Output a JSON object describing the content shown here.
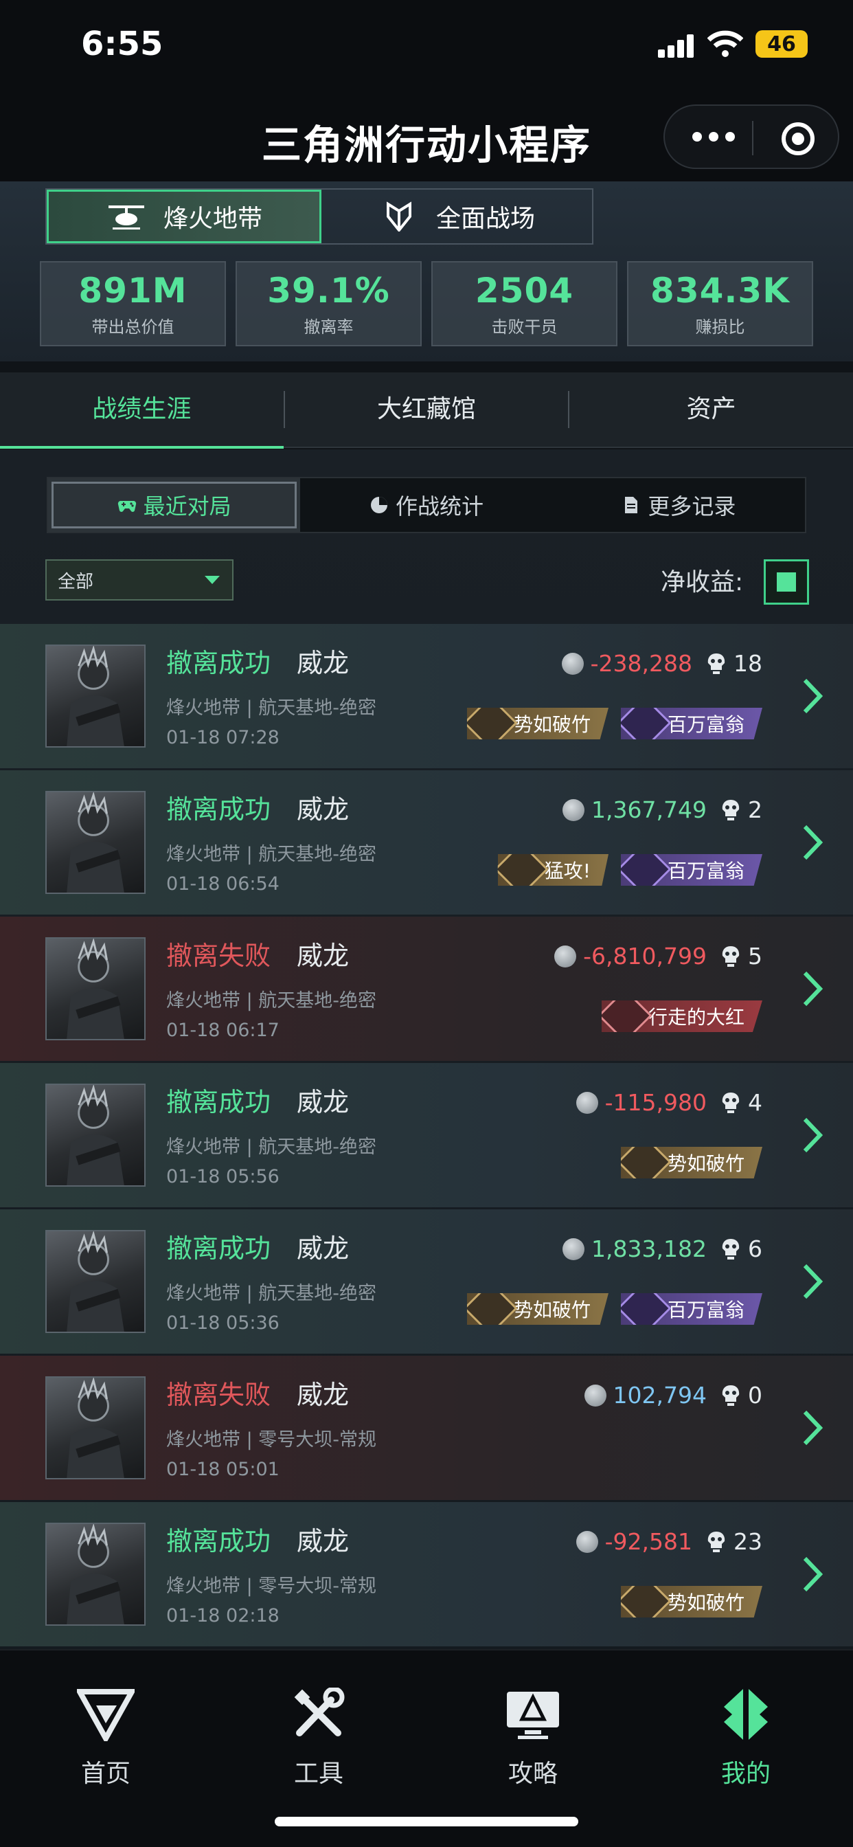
{
  "status_bar": {
    "time": "6:55",
    "battery": "46"
  },
  "header": {
    "title": "三角洲行动小程序"
  },
  "mode_tabs": [
    {
      "label": "烽火地带",
      "active": true
    },
    {
      "label": "全面战场",
      "active": false
    }
  ],
  "stats": [
    {
      "value": "891M",
      "label": "带出总价值"
    },
    {
      "value": "39.1%",
      "label": "撤离率"
    },
    {
      "value": "2504",
      "label": "击败干员"
    },
    {
      "value": "834.3K",
      "label": "赚损比"
    }
  ],
  "main_tabs": [
    {
      "label": "战绩生涯",
      "active": true
    },
    {
      "label": "大红藏馆",
      "active": false
    },
    {
      "label": "资产",
      "active": false
    }
  ],
  "segments": [
    {
      "label": "最近对局",
      "icon": "gamepad-icon",
      "active": true
    },
    {
      "label": "作战统计",
      "icon": "pie-chart-icon",
      "active": false
    },
    {
      "label": "更多记录",
      "icon": "document-icon",
      "active": false
    }
  ],
  "filter": {
    "value": "全部",
    "net_label": "净收益:"
  },
  "matches": [
    {
      "status": "撤离成功",
      "result": "success",
      "operator": "威龙",
      "map": "烽火地带 | 航天基地-绝密",
      "time": "01-18 07:28",
      "value": "-238,288",
      "value_tone": "neg",
      "kills": "18",
      "badges": [
        {
          "label": "势如破竹",
          "tone": "gold"
        },
        {
          "label": "百万富翁",
          "tone": "purple"
        }
      ]
    },
    {
      "status": "撤离成功",
      "result": "success",
      "operator": "威龙",
      "map": "烽火地带 | 航天基地-绝密",
      "time": "01-18 06:54",
      "value": "1,367,749",
      "value_tone": "pos",
      "kills": "2",
      "badges": [
        {
          "label": "猛攻!",
          "tone": "gold"
        },
        {
          "label": "百万富翁",
          "tone": "purple"
        }
      ]
    },
    {
      "status": "撤离失败",
      "result": "fail",
      "operator": "威龙",
      "map": "烽火地带 | 航天基地-绝密",
      "time": "01-18 06:17",
      "value": "-6,810,799",
      "value_tone": "neg",
      "kills": "5",
      "badges": [
        {
          "label": "行走的大红",
          "tone": "red"
        }
      ]
    },
    {
      "status": "撤离成功",
      "result": "success",
      "operator": "威龙",
      "map": "烽火地带 | 航天基地-绝密",
      "time": "01-18 05:56",
      "value": "-115,980",
      "value_tone": "neg",
      "kills": "4",
      "badges": [
        {
          "label": "势如破竹",
          "tone": "gold"
        }
      ]
    },
    {
      "status": "撤离成功",
      "result": "success",
      "operator": "威龙",
      "map": "烽火地带 | 航天基地-绝密",
      "time": "01-18 05:36",
      "value": "1,833,182",
      "value_tone": "pos",
      "kills": "6",
      "badges": [
        {
          "label": "势如破竹",
          "tone": "gold"
        },
        {
          "label": "百万富翁",
          "tone": "purple"
        }
      ]
    },
    {
      "status": "撤离失败",
      "result": "fail",
      "operator": "威龙",
      "map": "烽火地带 | 零号大坝-常规",
      "time": "01-18 05:01",
      "value": "102,794",
      "value_tone": "blue",
      "kills": "0",
      "badges": []
    },
    {
      "status": "撤离成功",
      "result": "success",
      "operator": "威龙",
      "map": "烽火地带 | 零号大坝-常规",
      "time": "01-18 02:18",
      "value": "-92,581",
      "value_tone": "neg",
      "kills": "23",
      "badges": [
        {
          "label": "势如破竹",
          "tone": "gold"
        }
      ]
    }
  ],
  "tabbar": [
    {
      "label": "首页",
      "icon": "logo-icon",
      "active": false
    },
    {
      "label": "工具",
      "icon": "tools-icon",
      "active": false
    },
    {
      "label": "攻略",
      "icon": "guide-icon",
      "active": false
    },
    {
      "label": "我的",
      "icon": "profile-icon",
      "active": true
    }
  ],
  "colors": {
    "accent": "#55e39a",
    "negative": "#f05a5f",
    "positive": "#6fe0a4",
    "info": "#7fc6f2",
    "fail": "#e0575b"
  }
}
